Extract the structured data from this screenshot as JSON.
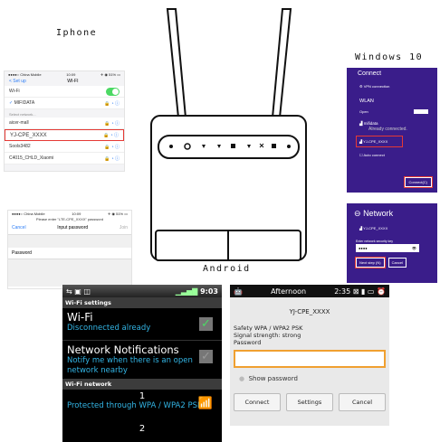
{
  "labels": {
    "iphone": "Iphone",
    "windows": "Windows 10",
    "android": "Android"
  },
  "iphone1": {
    "carrier": "●●●●○ China Mobile",
    "time": "10:09",
    "battery": "✈ ◉ 51% ▭",
    "back": "< Set up",
    "title": "WI-FI",
    "wifi_label": "Wi-Fi",
    "connected": "MIFIDATA",
    "select_network": "Select network...",
    "networks": [
      "aicer-mall",
      "YJ-CPE_XXXX",
      "Sools3482",
      "C4015_CHLD_Xiaomi"
    ]
  },
  "iphone2": {
    "carrier": "●●●●○ China Mobile",
    "time": "10:09",
    "battery": "✈ ◉ 51% ▭",
    "prompt": "Please enter \"LTE-CPE_XXXX\" password",
    "cancel": "Cancel",
    "title": "Input password",
    "join": "Join",
    "password_label": "Password"
  },
  "windows1": {
    "title": "Connect",
    "vpn": "VPN connection",
    "wlan": "WLAN",
    "open": "Open",
    "net1": "mifidata",
    "net1_status": "Already connected.",
    "net2": "YJ-CPE_XXXX",
    "auto_connect": "Auto connect",
    "connect_btn": "Connect(C)"
  },
  "windows2": {
    "title": "Network",
    "ssid": "YJ-CPE_XXXX",
    "key_prompt": "Enter network security key",
    "key_value": "●●●●",
    "next": "Next step (N)",
    "cancel": "Cancel"
  },
  "android1": {
    "time": "9:03",
    "header": "Wi-Fi settings",
    "wifi": "Wi-Fi",
    "wifi_sub": "Disconnected already",
    "notif": "Network Notifications",
    "notif_sub": "Notify me when there is an open network nearby",
    "network_hdr": "Wi-Fi network",
    "item1_num": "1",
    "item1_sub": "Protected through WPA / WPA2 PSK",
    "item2_num": "2"
  },
  "android2": {
    "title": "Afternoon",
    "time": "2:35",
    "ssid": "YJ-CPE_XXXX",
    "security": "Safety WPA / WPA2 PSK",
    "strength": "Signal strength: strong",
    "password": "Password",
    "show_password": "Show password",
    "connect": "Connect",
    "settings": "Settings",
    "cancel": "Cancel"
  },
  "colors": {
    "ios_blue": "#2b7cf6",
    "ios_green": "#4cd964",
    "win_purple": "#3a1d8a",
    "android_blue": "#33b5e5",
    "highlight_red": "#e53935",
    "input_orange": "#f0a030"
  }
}
